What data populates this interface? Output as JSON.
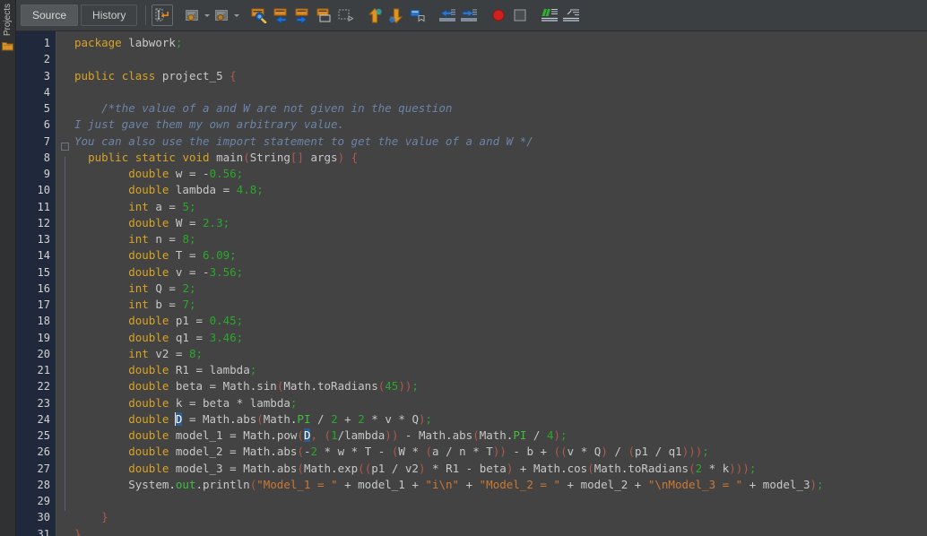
{
  "window": {
    "app": "NetBeans IDE",
    "file": "project_5.java"
  },
  "left_dock": {
    "label": "Projects",
    "icon": "projects-folder-icon"
  },
  "tabs": [
    {
      "label": "Source",
      "active": true
    },
    {
      "label": "History",
      "active": false
    }
  ],
  "toolbar": {
    "groups": [
      {
        "name": "editing",
        "buttons": [
          {
            "name": "toggle-rectangular-selection-icon",
            "title": "Toggle Rectangular Selection",
            "framed": true,
            "caret": false
          },
          {
            "name": "last-edit-icon",
            "title": "Last Edit",
            "framed": false,
            "caret": true
          },
          {
            "name": "back-edit-icon",
            "title": "Back",
            "framed": false,
            "caret": true
          }
        ]
      },
      {
        "name": "navigation",
        "buttons": [
          {
            "name": "find-selection-icon",
            "title": "Find Selection",
            "framed": false,
            "caret": false
          },
          {
            "name": "find-previous-icon",
            "title": "Find Previous Occurrence",
            "framed": false,
            "caret": false
          },
          {
            "name": "find-next-icon",
            "title": "Find Next Occurrence",
            "framed": false,
            "caret": false
          },
          {
            "name": "toggle-highlight-search-icon",
            "title": "Toggle Highlight Search",
            "framed": false,
            "caret": false
          },
          {
            "name": "previous-bookmark-icon",
            "title": "Previous Bookmark",
            "framed": false,
            "caret": false
          }
        ]
      },
      {
        "name": "bookmarks",
        "buttons": [
          {
            "name": "previous-error-icon",
            "title": "Previous Error",
            "framed": false,
            "caret": false
          },
          {
            "name": "next-error-icon",
            "title": "Next Error",
            "framed": false,
            "caret": false
          },
          {
            "name": "toggle-bookmark-icon",
            "title": "Toggle Bookmark",
            "framed": false,
            "caret": false
          }
        ]
      },
      {
        "name": "indent",
        "buttons": [
          {
            "name": "shift-line-left-icon",
            "title": "Shift Line Left",
            "framed": false,
            "caret": false
          },
          {
            "name": "shift-line-right-icon",
            "title": "Shift Line Right",
            "framed": false,
            "caret": false
          }
        ]
      },
      {
        "name": "macro",
        "buttons": [
          {
            "name": "start-macro-recording-icon",
            "title": "Start Macro Recording",
            "framed": false,
            "caret": false
          },
          {
            "name": "stop-macro-recording-icon",
            "title": "Stop Macro Recording",
            "framed": false,
            "caret": false
          }
        ]
      },
      {
        "name": "diff",
        "buttons": [
          {
            "name": "show-diff-icon",
            "title": "Show Diff",
            "framed": false,
            "caret": false
          },
          {
            "name": "toggle-line-wrap-icon",
            "title": "Toggle Line Wrap",
            "framed": false,
            "caret": false
          }
        ]
      }
    ]
  },
  "editor": {
    "first_line": 1,
    "last_line": 31,
    "line_numbers": [
      1,
      2,
      3,
      4,
      5,
      6,
      7,
      8,
      9,
      10,
      11,
      12,
      13,
      14,
      15,
      16,
      17,
      18,
      19,
      20,
      21,
      22,
      23,
      24,
      25,
      26,
      27,
      28,
      29,
      30,
      31
    ],
    "fold_marker_line": 8,
    "highlighted_token": "D",
    "caret_line": 24,
    "lines": [
      {
        "n": 1,
        "text": "package labwork;"
      },
      {
        "n": 2,
        "text": ""
      },
      {
        "n": 3,
        "text": "public class project_5 {"
      },
      {
        "n": 4,
        "text": ""
      },
      {
        "n": 5,
        "text": "    /*the value of a and W are not given in the question"
      },
      {
        "n": 6,
        "text": "I just gave them my own arbitrary value."
      },
      {
        "n": 7,
        "text": "You can also use the import statement to get the value of a and W */"
      },
      {
        "n": 8,
        "text": "  public static void main(String[] args) {"
      },
      {
        "n": 9,
        "text": "        double w = -0.56;"
      },
      {
        "n": 10,
        "text": "        double lambda = 4.8;"
      },
      {
        "n": 11,
        "text": "        int a = 5;"
      },
      {
        "n": 12,
        "text": "        double W = 2.3;"
      },
      {
        "n": 13,
        "text": "        int n = 8;"
      },
      {
        "n": 14,
        "text": "        double T = 6.09;"
      },
      {
        "n": 15,
        "text": "        double v = -3.56;"
      },
      {
        "n": 16,
        "text": "        int Q = 2;"
      },
      {
        "n": 17,
        "text": "        int b = 7;"
      },
      {
        "n": 18,
        "text": "        double p1 = 0.45;"
      },
      {
        "n": 19,
        "text": "        double q1 = 3.46;"
      },
      {
        "n": 20,
        "text": "        int v2 = 8;"
      },
      {
        "n": 21,
        "text": "        double R1 = lambda;"
      },
      {
        "n": 22,
        "text": "        double beta = Math.sin(Math.toRadians(45));"
      },
      {
        "n": 23,
        "text": "        double k = beta * lambda;"
      },
      {
        "n": 24,
        "text": "        double D = Math.abs(Math.PI / 2 + 2 * v * Q);"
      },
      {
        "n": 25,
        "text": "        double model_1 = Math.pow(D, (1/lambda)) - Math.abs(Math.PI / 4);"
      },
      {
        "n": 26,
        "text": "        double model_2 = Math.abs(-2 * w * T - (W * (a / n * T)) - b + ((v * Q) / (p1 / q1)));"
      },
      {
        "n": 27,
        "text": "        double model_3 = Math.abs(Math.exp((p1 / v2) * R1 - beta) + Math.cos(Math.toRadians(2 * k)));"
      },
      {
        "n": 28,
        "text": "        System.out.println(\"Model_1 = \" + model_1 + \"i\\n\" + \"Model_2 = \" + model_2 + \"\\nModel_3 = \" + model_3);"
      },
      {
        "n": 29,
        "text": ""
      },
      {
        "n": 30,
        "text": "    }"
      },
      {
        "n": 31,
        "text": "}"
      }
    ]
  },
  "colors": {
    "editor_bg": "#434343",
    "gutter_bg": "#20293b",
    "toolbar_bg": "#3c3f41",
    "keyword": "#d8a326",
    "number": "#2aa82a",
    "string": "#cc7832",
    "comment": "#6b84a8",
    "paren": "#b05a4a",
    "static_field": "#3fbf3f",
    "highlight": "#2f5b93",
    "text": "#d6d6d6"
  }
}
